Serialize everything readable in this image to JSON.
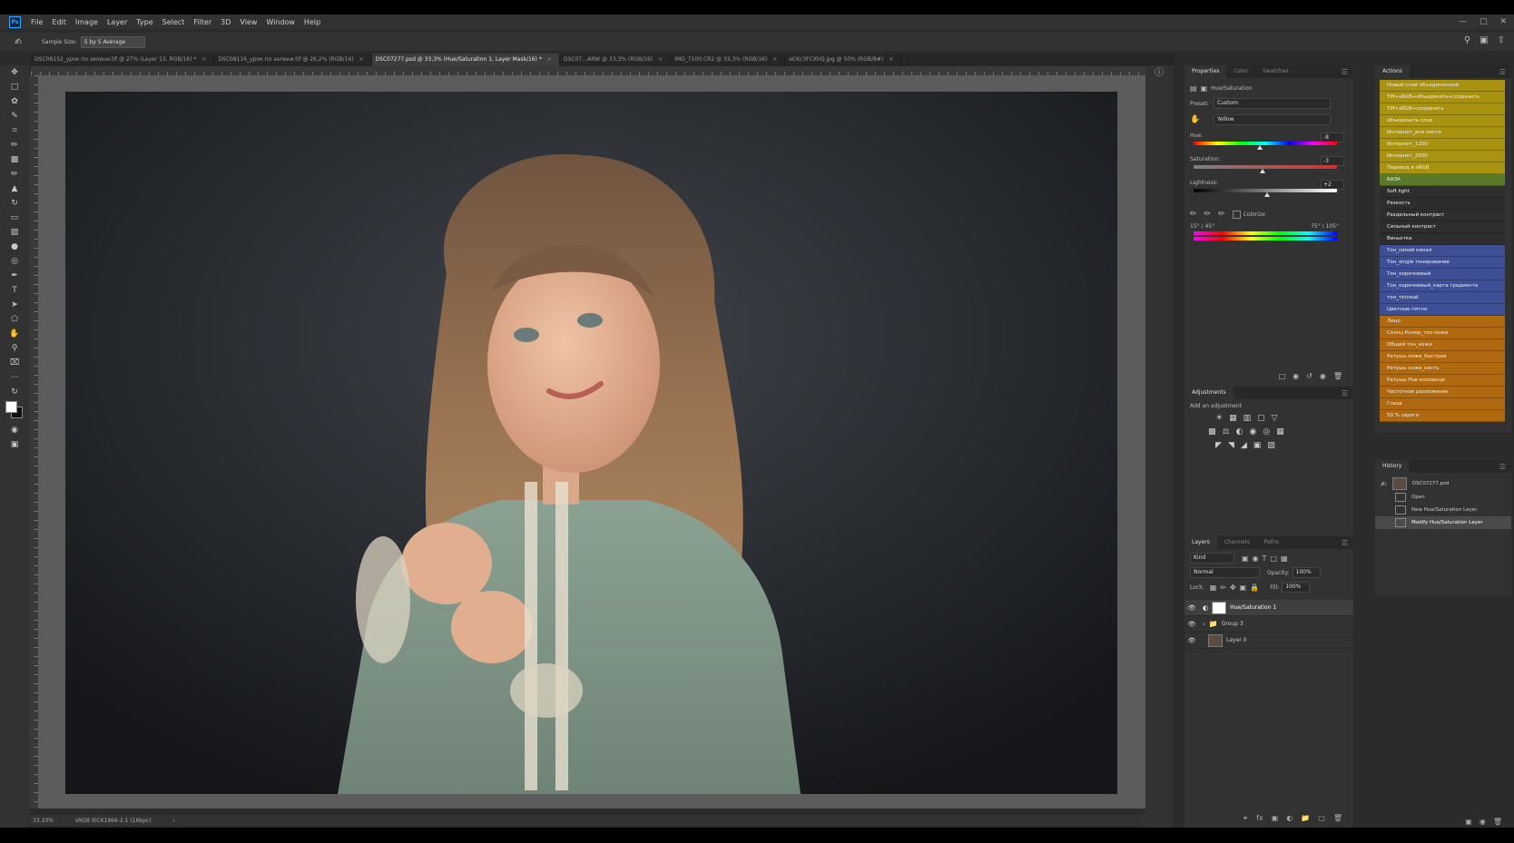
{
  "app": {
    "logo": "Ps",
    "menu": [
      "File",
      "Edit",
      "Image",
      "Layer",
      "Type",
      "Select",
      "Filter",
      "3D",
      "View",
      "Window",
      "Help"
    ]
  },
  "options_bar": {
    "sample_size_label": "Sample Size:",
    "sample_size_value": "5 by 5 Average"
  },
  "doc_tabs": [
    {
      "label": "DSC08152_урок по зелени.tif @ 27% (Layer 13, RGB/16) *",
      "active": false
    },
    {
      "label": "DSC08116_урок по зелени.tif @ 26,2% (RGB/16)",
      "active": false
    },
    {
      "label": "DSC07277.psd @ 33,3% (Hue/Saturation 1, Layer Mask/16) *",
      "active": true
    },
    {
      "label": "DSC07…ARW @ 33,3% (RGB/16)",
      "active": false
    },
    {
      "label": "IMG_7100.CR2 @ 33,3% (RGB/16)",
      "active": false
    },
    {
      "label": "eCKc3FCXhQ.jpg @ 50% (RGB/8#)",
      "active": false
    }
  ],
  "status": {
    "zoom": "33,33%",
    "profile": "sRGB IEC61966-2.1 (16bpc)"
  },
  "properties": {
    "tabs": [
      "Properties",
      "Color",
      "Swatches"
    ],
    "title": "Hue/Saturation",
    "preset_label": "Preset:",
    "preset_value": "Custom",
    "channel_value": "Yellow",
    "hue_label": "Hue:",
    "hue_value": "-8",
    "saturation_label": "Saturation:",
    "saturation_value": "-3",
    "lightness_label": "Lightness:",
    "lightness_value": "+2",
    "colorize_label": "Colorize",
    "range_left": "15° / 45°",
    "range_right": "75° \\ 105°"
  },
  "adjustments": {
    "title": "Adjustments",
    "subtitle": "Add an adjustment"
  },
  "layers_panel": {
    "tabs": [
      "Layers",
      "Channels",
      "Paths"
    ],
    "kind_label": "Kind",
    "blend_mode": "Normal",
    "opacity_label": "Opacity:",
    "opacity_value": "100%",
    "lock_label": "Lock:",
    "fill_label": "Fill:",
    "fill_value": "100%",
    "layers": [
      {
        "name": "Hue/Saturation 1",
        "selected": true
      },
      {
        "name": "Group 3",
        "selected": false
      },
      {
        "name": "Layer 0",
        "selected": false
      }
    ]
  },
  "actions": {
    "title": "Actions",
    "items": [
      {
        "label": "Новый слой объединенный",
        "color": "#a8920f"
      },
      {
        "label": "Tiff+sRGB+объединить+сохранить",
        "color": "#a8920f"
      },
      {
        "label": "Tiff+sRGB+сохранить",
        "color": "#a8920f"
      },
      {
        "label": "объединить слои",
        "color": "#a8920f"
      },
      {
        "label": "Интернет_для кисти",
        "color": "#a8920f"
      },
      {
        "label": "Интернет_1200",
        "color": "#a8920f"
      },
      {
        "label": "Интернет_2000",
        "color": "#a8920f"
      },
      {
        "label": "Перевод в sRGB",
        "color": "#a8920f"
      },
      {
        "label": "БАЗА",
        "color": "#5a7a2a"
      },
      {
        "label": "Soft light",
        "color": "#2e2e2e"
      },
      {
        "label": "Резкость",
        "color": "#2e2e2e"
      },
      {
        "label": "Раздельный контраст",
        "color": "#2e2e2e"
      },
      {
        "label": "Сильный контраст",
        "color": "#2e2e2e"
      },
      {
        "label": "Виньетка",
        "color": "#2e2e2e"
      },
      {
        "label": "Тон_синий канал",
        "color": "#3e4f96"
      },
      {
        "label": "Тон_single тонирование",
        "color": "#3e4f96"
      },
      {
        "label": "Тон_коричневый",
        "color": "#3e4f96"
      },
      {
        "label": "Тон_коричневый_карта градиента",
        "color": "#3e4f96"
      },
      {
        "label": "тон_теплый",
        "color": "#3e4f96"
      },
      {
        "label": "Цветные пятна",
        "color": "#3e4f96"
      },
      {
        "label": "Лицо",
        "color": "#b0690f"
      },
      {
        "label": "Солнц Колор_тон кожи",
        "color": "#b0690f"
      },
      {
        "label": "Общий тон_кожи",
        "color": "#b0690f"
      },
      {
        "label": "Ретушь кожи_быстрая",
        "color": "#b0690f"
      },
      {
        "label": "Ретушь кожи_кисть",
        "color": "#b0690f"
      },
      {
        "label": "Ретушь Hue коллекци",
        "color": "#b0690f"
      },
      {
        "label": "Частотное разложение",
        "color": "#b0690f"
      },
      {
        "label": "Глаза",
        "color": "#b0690f"
      },
      {
        "label": "50 % серого",
        "color": "#b0690f"
      }
    ]
  },
  "history": {
    "title": "History",
    "snapshot": "DSC07277.psd",
    "items": [
      {
        "label": "Open",
        "selected": false
      },
      {
        "label": "New Hue/Saturation Layer",
        "selected": false
      },
      {
        "label": "Modify Hue/Saturation Layer",
        "selected": true
      }
    ]
  }
}
